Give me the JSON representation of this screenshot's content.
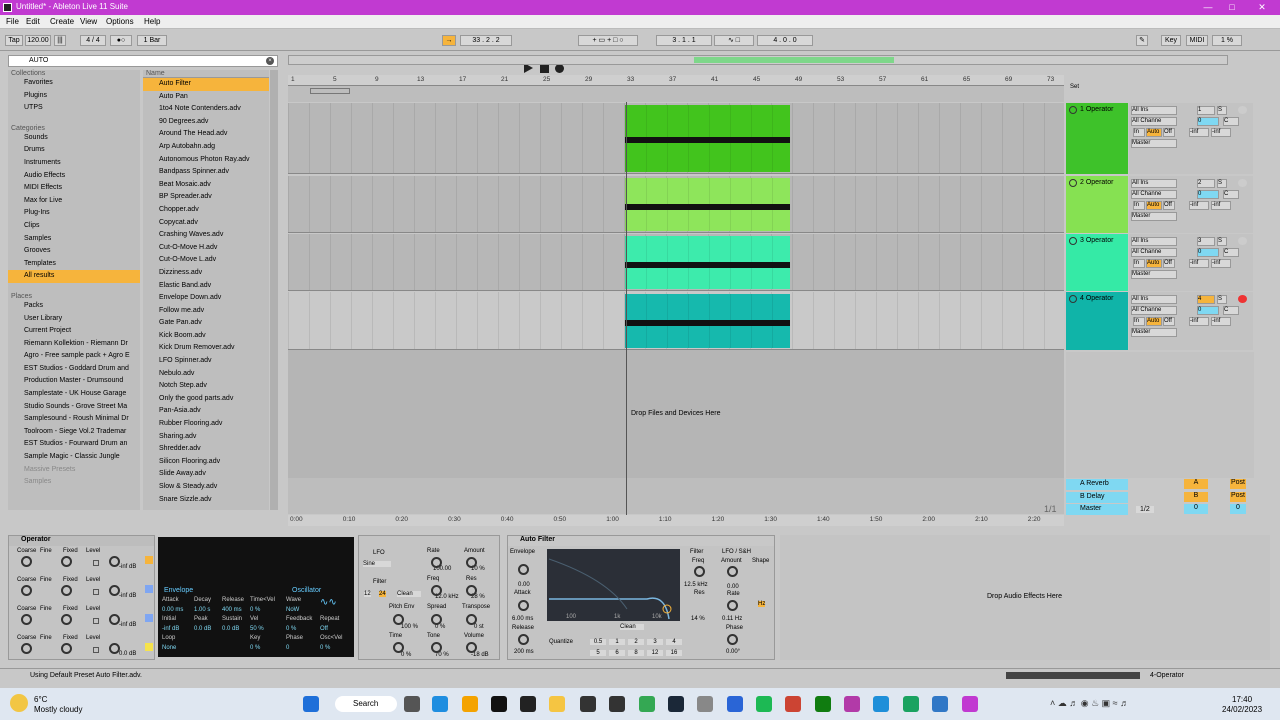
{
  "window": {
    "title": "Untitled* - Ableton Live 11 Suite"
  },
  "menu": [
    "File",
    "Edit",
    "Create",
    "View",
    "Options",
    "Help"
  ],
  "transport": {
    "tap": "Tap",
    "tempo": "120.00",
    "signature": "4 / 4",
    "quantize": "1 Bar",
    "position": "33 .  2 .  2",
    "loop_start": "3 .  1 .  1",
    "loop_length": "4 .  0 .  0",
    "key": "Key",
    "midi": "MIDI",
    "cpu": "1 %"
  },
  "browser": {
    "search": "AUTO",
    "collections_header": "Collections",
    "collections": [
      "Favorites",
      "Plugins",
      "UTPS"
    ],
    "categories_header": "Categories",
    "categories": [
      "Sounds",
      "Drums",
      "Instruments",
      "Audio Effects",
      "MIDI Effects",
      "Max for Live",
      "Plug-Ins",
      "Clips",
      "Samples",
      "Grooves",
      "Templates",
      "All results"
    ],
    "places_header": "Places",
    "places": [
      "Packs",
      "User Library",
      "Current Project",
      "Riemann Kollektion - Riemann Dr",
      "Agro - Free sample pack + Agro E",
      "EST Studios - Goddard Drum and",
      "Production Master - Drumsound",
      "Samplestate - UK House Garage",
      "Studio Sounds - Grove Street Ma",
      "Samplesound - Roush Minimal Dr",
      "Toolroom - Siege Vol.2 Trademar",
      "EST Studios - Fourward Drum an",
      "Sample Magic - Classic Jungle",
      "Massive Presets",
      "Samples"
    ],
    "name_header": "Name",
    "files": [
      "Auto Filter",
      "Auto Pan",
      "1to4 Note Contenders.adv",
      "90 Degrees.adv",
      "Around The Head.adv",
      "Arp Autobahn.adg",
      "Autonomous Photon Ray.adv",
      "Bandpass Spinner.adv",
      "Beat Mosaic.adv",
      "BP Spreader.adv",
      "Chopper.adv",
      "Copycat.adv",
      "Crashing Waves.adv",
      "Cut-O-Move H.adv",
      "Cut-O-Move L.adv",
      "Dizziness.adv",
      "Elastic Band.adv",
      "Envelope Down.adv",
      "Follow me.adv",
      "Gate Pan.adv",
      "Kick Boom.adv",
      "Kick Drum Remover.adv",
      "LFO Spinner.adv",
      "Nebulo.adv",
      "Notch Step.adv",
      "Only the good parts.adv",
      "Pan-Asia.adv",
      "Rubber Flooring.adv",
      "Sharing.adv",
      "Shredder.adv",
      "Silicon Flooring.adv",
      "Slide Away.adv",
      "Slow & Steady.adv",
      "Snare Sizzle.adv"
    ]
  },
  "ruler": [
    "1",
    "5",
    "9",
    "13",
    "17",
    "21",
    "25",
    "29",
    "33",
    "37",
    "41",
    "45",
    "49",
    "53",
    "57",
    "61",
    "65",
    "69",
    "73"
  ],
  "time": [
    "0:00",
    "0:10",
    "0:20",
    "0:30",
    "0:40",
    "0:50",
    "1:00",
    "1:10",
    "1:20",
    "1:30",
    "1:40",
    "1:50",
    "2:00",
    "2:10",
    "2:20"
  ],
  "tracks": [
    {
      "name": "1 Operator",
      "num": "1",
      "color": "#3ec22a",
      "clip": "#42c41d",
      "io1": "All Ins",
      "io2": "All Channe",
      "vol": "0",
      "pan": "C",
      "send": "-inf"
    },
    {
      "name": "2 Operator",
      "num": "2",
      "color": "#86e152",
      "clip": "#8ee55b",
      "io1": "All Ins",
      "io2": "All Channe",
      "vol": "0",
      "pan": "C",
      "send": "-inf"
    },
    {
      "name": "3 Operator",
      "num": "3",
      "color": "#35eaa6",
      "clip": "#3debac",
      "io1": "All Ins",
      "io2": "All Channe",
      "vol": "0",
      "pan": "C",
      "send": "-inf"
    },
    {
      "name": "4 Operator",
      "num": "4",
      "color": "#10b4a8",
      "clip": "#16b9ad",
      "io1": "All Ins",
      "io2": "All Channe",
      "vol": "0",
      "pan": "C",
      "send": "-inf"
    }
  ],
  "track_io": {
    "in": "In",
    "auto": "Auto",
    "off": "Off",
    "master": "Master",
    "s": "S"
  },
  "returns": [
    {
      "name": "A Reverb",
      "letter": "A",
      "post": "Post"
    },
    {
      "name": "B Delay",
      "letter": "B",
      "post": "Post"
    },
    {
      "name": "Master",
      "letter": "0",
      "post": "0"
    }
  ],
  "set_label": "Set",
  "drop_tracks": "Drop Files and Devices Here",
  "page": "1/1",
  "master_out": "1/2",
  "operator": {
    "title": "Operator",
    "labels": [
      "Coarse",
      "Fine",
      "Fixed",
      "Level"
    ],
    "levels": [
      "-inf dB",
      "-inf dB",
      "-inf dB",
      "0.0 dB"
    ],
    "env_title": "Envelope",
    "osc_title": "Oscillator",
    "attack": "Attack",
    "decay": "Decay",
    "release": "Release",
    "timevel": "Time<Vel",
    "wave": "Wave",
    "attack_v": "0.00 ms",
    "decay_v": "1.00 s",
    "release_v": "400 ms",
    "timevel_v": "0 %",
    "wave_v": "NoW",
    "initial": "Initial",
    "peak": "Peak",
    "sustain": "Sustain",
    "vel": "Vel",
    "feedback": "Feedback",
    "repeat": "Repeat",
    "initial_v": "-inf dB",
    "peak_v": "0.0 dB",
    "sustain_v": "0.0 dB",
    "vel_v": "50 %",
    "feedback_v": "0 %",
    "repeat_v": "Off",
    "loop": "Loop",
    "key": "Key",
    "phase": "Phase",
    "oscvel": "Osc<Vel",
    "loop_v": "None",
    "key_v": "0 %",
    "phase_v": "0",
    "oscvel_v": "0 %"
  },
  "lfo": {
    "lfo": "LFO",
    "sine": "Sine",
    "rate": "Rate",
    "amount": "Amount",
    "rate_v": "100.00",
    "amount_v": "10 %",
    "filter": "Filter",
    "clean": "Clean",
    "freq": "Freq",
    "res": "Res",
    "freq_v": "12.0 kHz",
    "res_v": "28 %",
    "pitchenv": "Pitch Env",
    "spread": "Spread",
    "transpose": "Transpose",
    "pitch_v": "100 %",
    "spread_v": "0 %",
    "transpose_v": "0 st",
    "time": "Time",
    "tone": "Tone",
    "volume": "Volume",
    "time_v": "0 %",
    "tone_v": "70 %",
    "volume_v": "-18 dB",
    "n12": "12",
    "n24": "24"
  },
  "autofilter": {
    "title": "Auto Filter",
    "envelope": "Envelope",
    "env_v": "0.00",
    "attack": "Attack",
    "attack_v": "6.00 ms",
    "release": "Release",
    "release_v": "200 ms",
    "filter": "Filter",
    "freq": "Freq",
    "freq_v": "12.5 kHz",
    "res": "Res",
    "res_v": "14 %",
    "lfo": "LFO / S&H",
    "amount": "Amount",
    "amount_v": "0.00",
    "shape": "Shape",
    "rate": "Rate",
    "rate_v": "0.11 Hz",
    "phase": "Phase",
    "phase_v": "0.00°",
    "clean": "Clean",
    "quantize": "Quantize",
    "q": [
      "0.5",
      "1",
      "2",
      "3",
      "4",
      "5",
      "6",
      "8",
      "12",
      "16"
    ],
    "hz": "Hz",
    "f100": "100",
    "f1k": "1k",
    "f10k": "10k"
  },
  "drop_effects": "Drop Audio Effects Here",
  "status": {
    "text": "Using Default Preset Auto Filter.adv.",
    "right": "4-Operator"
  },
  "taskbar": {
    "temp": "6°C",
    "weather": "Mostly cloudy",
    "search": "Search",
    "time": "17:40",
    "date": "24/02/2023"
  }
}
